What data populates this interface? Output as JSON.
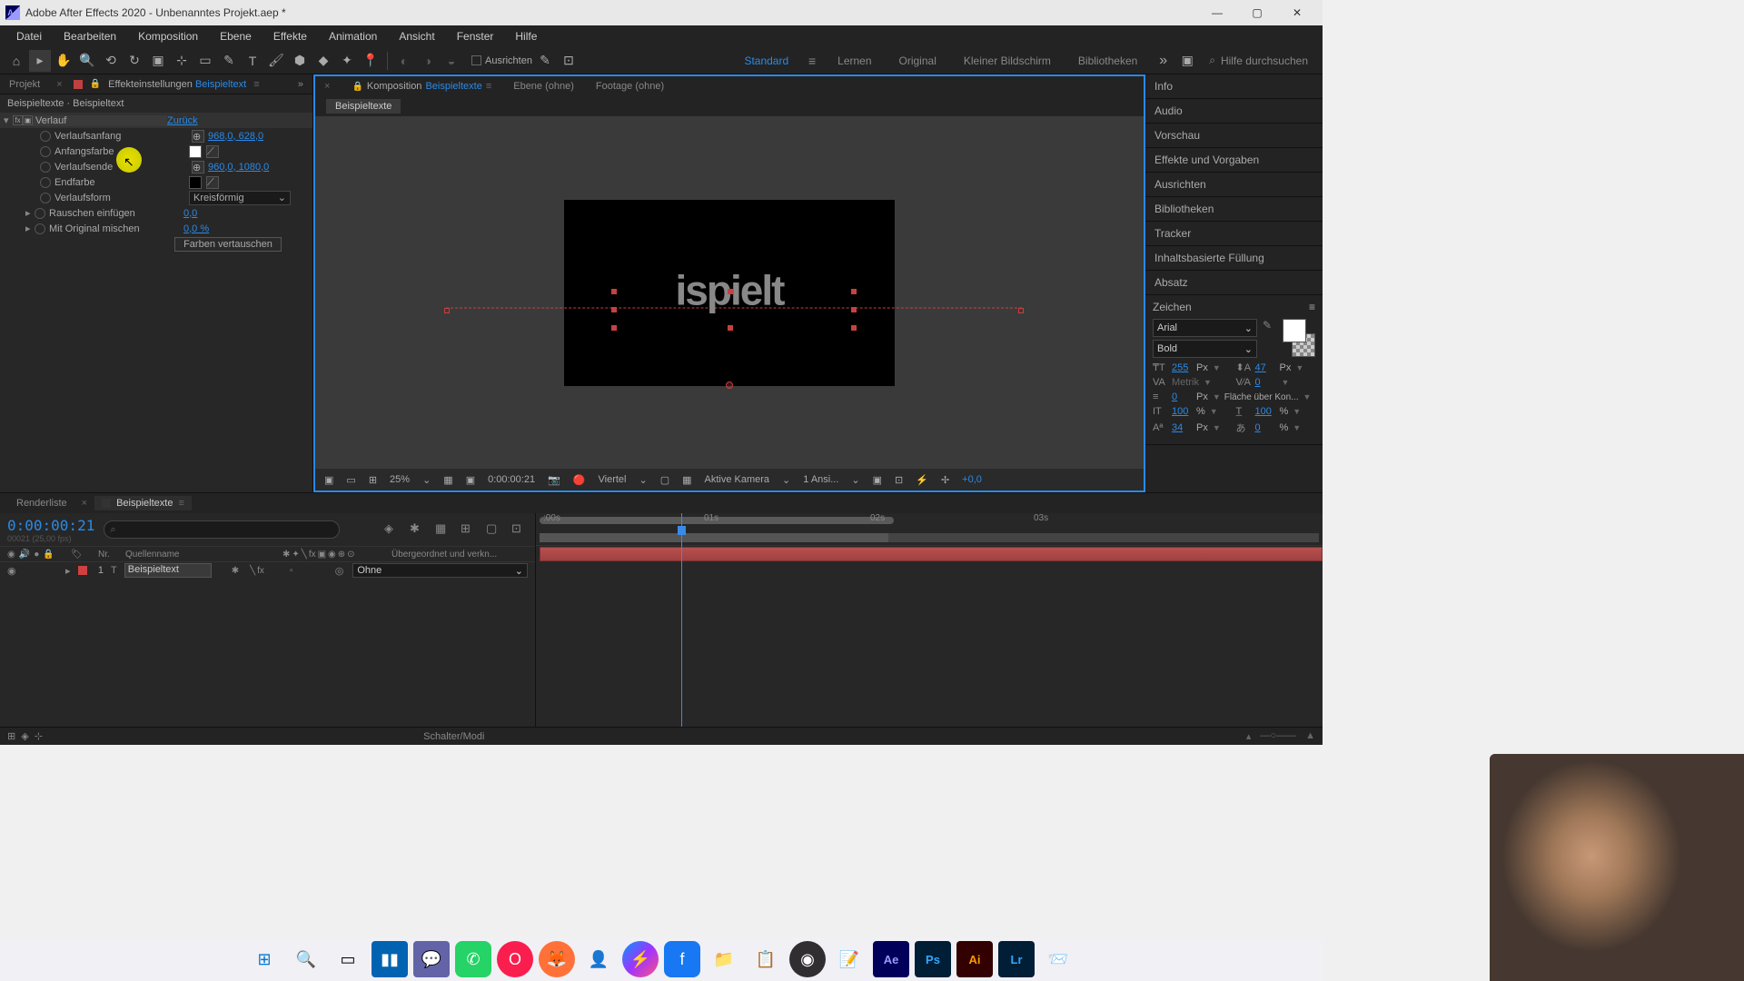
{
  "titlebar": {
    "title": "Adobe After Effects 2020 - Unbenanntes Projekt.aep *"
  },
  "menubar": [
    "Datei",
    "Bearbeiten",
    "Komposition",
    "Ebene",
    "Effekte",
    "Animation",
    "Ansicht",
    "Fenster",
    "Hilfe"
  ],
  "toolbar": {
    "align_label": "Ausrichten",
    "workspace_active": "Standard",
    "workspaces": [
      "Lernen",
      "Original",
      "Kleiner Bildschirm",
      "Bibliotheken"
    ],
    "search_placeholder": "Hilfe durchsuchen"
  },
  "left_panel": {
    "tab_project": "Projekt",
    "tab_effects_prefix": "Effekteinstellungen",
    "tab_effects_subject": "Beispieltext",
    "breadcrumb": "Beispieltexte · Beispieltext",
    "effect": {
      "name": "Verlauf",
      "reset": "Zurück",
      "rows": [
        {
          "label": "Verlaufsanfang",
          "value": "968,0, 628,0",
          "type": "point"
        },
        {
          "label": "Anfangsfarbe",
          "type": "color",
          "color": "#ffffff"
        },
        {
          "label": "Verlaufsende",
          "value": "960,0, 1080,0",
          "type": "point"
        },
        {
          "label": "Endfarbe",
          "type": "color",
          "color": "#000000"
        },
        {
          "label": "Verlaufsform",
          "value": "Kreisförmig",
          "type": "dropdown"
        },
        {
          "label": "Rauschen einfügen",
          "value": "0,0",
          "type": "number"
        },
        {
          "label": "Mit Original mischen",
          "value": "0,0 %",
          "type": "number"
        }
      ],
      "swap_button": "Farben vertauschen"
    }
  },
  "viewer": {
    "tabs": {
      "comp_prefix": "Komposition",
      "comp_name": "Beispieltexte",
      "layer": "Ebene (ohne)",
      "footage": "Footage (ohne)"
    },
    "subtab": "Beispieltexte",
    "canvas_text": "ispielt",
    "footer": {
      "zoom": "25%",
      "timecode": "0:00:00:21",
      "resolution": "Viertel",
      "camera": "Aktive Kamera",
      "views": "1 Ansi...",
      "exposure": "+0,0"
    }
  },
  "right_panel": {
    "sections": [
      "Info",
      "Audio",
      "Vorschau",
      "Effekte und Vorgaben",
      "Ausrichten",
      "Bibliotheken",
      "Tracker",
      "Inhaltsbasierte Füllung",
      "Absatz"
    ],
    "character": {
      "title": "Zeichen",
      "font": "Arial",
      "weight": "Bold",
      "size_val": "255",
      "size_unit": "Px",
      "leading_val": "47",
      "leading_unit": "Px",
      "kerning": "Metrik",
      "tracking_val": "0",
      "stroke_val": "0",
      "stroke_unit": "Px",
      "stroke_mode": "Fläche über Kon...",
      "hscale_val": "100",
      "hscale_unit": "%",
      "vscale_val": "100",
      "vscale_unit": "%",
      "baseline_val": "34",
      "baseline_unit": "Px",
      "tsume_val": "0",
      "tsume_unit": "%"
    }
  },
  "timeline": {
    "tab_render": "Renderliste",
    "tab_comp": "Beispieltexte",
    "timecode": "0:00:00:21",
    "framerate": "00021 (25,00 fps)",
    "col_nr": "Nr.",
    "col_name": "Quellenname",
    "col_parent": "Übergeordnet und verkn...",
    "layer": {
      "num": "1",
      "name": "Beispieltext",
      "parent": "Ohne"
    },
    "ticks": [
      ":00s",
      "01s",
      "02s",
      "03s"
    ],
    "footer": "Schalter/Modi"
  },
  "taskbar_icons": [
    "windows",
    "search",
    "tasks",
    "explorer",
    "teams",
    "whatsapp",
    "opera",
    "firefox",
    "app1",
    "messenger",
    "facebook",
    "folder",
    "app2",
    "obs",
    "notepad",
    "after-effects",
    "photoshop",
    "illustrator",
    "lightroom",
    "app3"
  ]
}
